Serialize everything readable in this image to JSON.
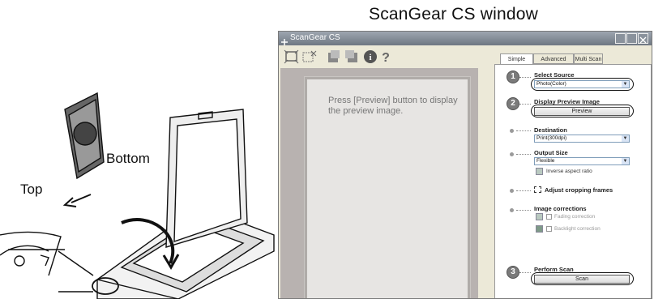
{
  "heading": "ScanGear CS window",
  "illustration": {
    "label_top": "Top",
    "label_bottom": "Bottom"
  },
  "window": {
    "title": "ScanGear CS",
    "preview_message": "Press [Preview] button to display the preview image.",
    "tabs": [
      "Simple Mode",
      "Advanced Mode",
      "Multi Scan"
    ],
    "steps": {
      "select_source": {
        "number": "1",
        "label": "Select Source",
        "value": "Photo(Color)"
      },
      "display_preview": {
        "number": "2",
        "label": "Display Preview Image",
        "button": "Preview"
      },
      "destination": {
        "label": "Destination",
        "value": "Print(300dpi)"
      },
      "output_size": {
        "label": "Output Size",
        "value": "Flexible",
        "inverse": "Inverse aspect ratio"
      },
      "cropping": {
        "label": "Adjust cropping frames"
      },
      "image_corrections": {
        "label": "Image corrections",
        "fading": "Fading correction",
        "backlight": "Backlight correction"
      },
      "perform_scan": {
        "number": "3",
        "label": "Perform Scan",
        "button": "Scan"
      }
    }
  },
  "colors": {
    "titlebar": "#7f8893",
    "preview_bg": "#b8b2b0",
    "panel": "#ece9d8"
  }
}
